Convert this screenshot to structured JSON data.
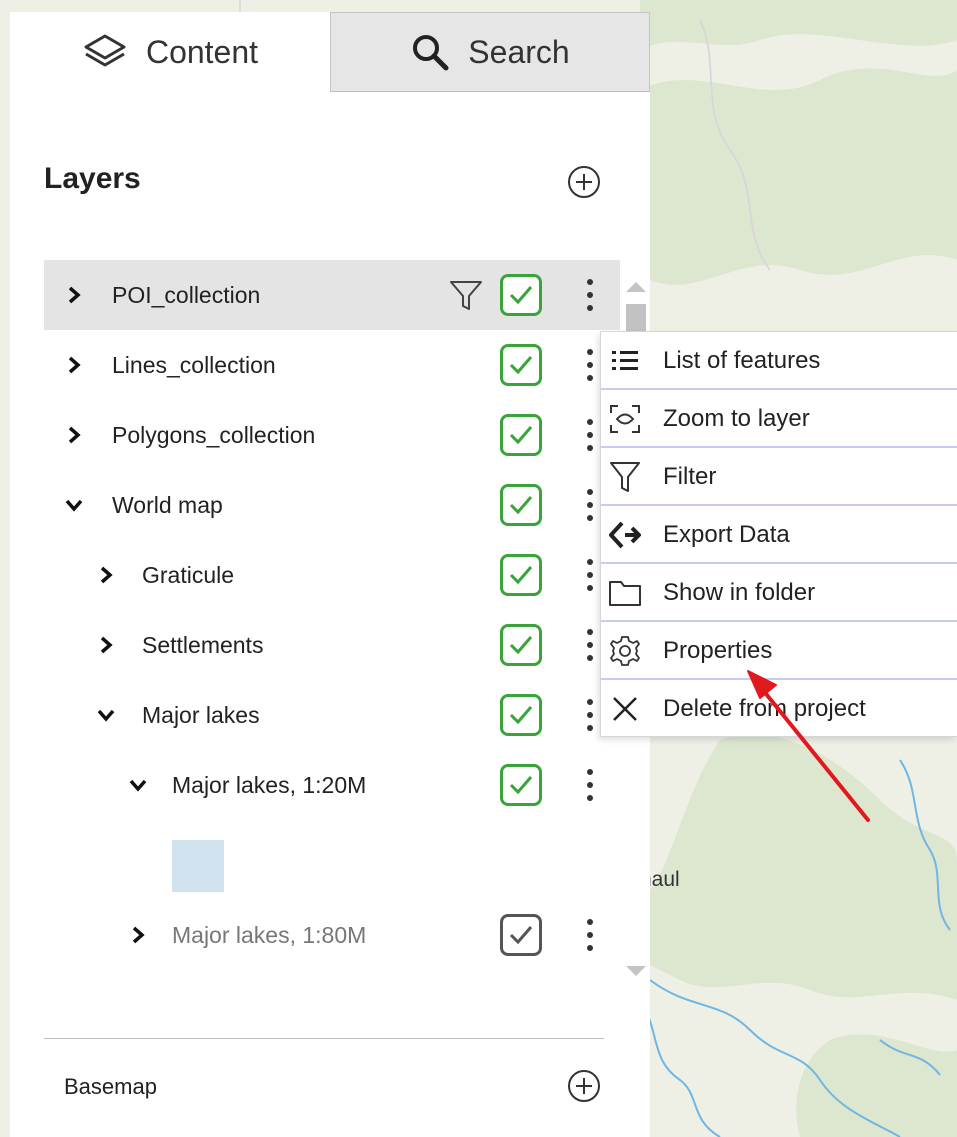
{
  "tabs": [
    {
      "label": "Content",
      "icon": "layers-icon",
      "active": true
    },
    {
      "label": "Search",
      "icon": "search-icon",
      "active": false
    }
  ],
  "layers": {
    "title": "Layers",
    "add_icon": "plus-circle-icon",
    "items": [
      {
        "label": "POI_collection",
        "expanded": false,
        "checked": true,
        "filtered": true,
        "selected": true
      },
      {
        "label": "Lines_collection",
        "expanded": false,
        "checked": true
      },
      {
        "label": "Polygons_collection",
        "expanded": false,
        "checked": true
      },
      {
        "label": "World map",
        "expanded": true,
        "checked": true
      },
      {
        "label": "Graticule",
        "expanded": false,
        "checked": true
      },
      {
        "label": "Settlements",
        "expanded": false,
        "checked": true
      },
      {
        "label": "Major lakes",
        "expanded": true,
        "checked": true
      },
      {
        "label": "Major lakes, 1:20M",
        "expanded": true,
        "checked": true
      },
      {
        "label": "Major lakes, 1:80M",
        "expanded": false,
        "checked": true,
        "muted": true
      }
    ],
    "legend_swatch_color": "#d2e3f0"
  },
  "basemap": {
    "title": "Basemap",
    "add_icon": "plus-circle-icon"
  },
  "context_menu": {
    "items": [
      {
        "label": "List of features",
        "icon": "list-icon"
      },
      {
        "label": "Zoom to layer",
        "icon": "zoom-extent-icon"
      },
      {
        "label": "Filter",
        "icon": "filter-icon"
      },
      {
        "label": "Export Data",
        "icon": "export-icon"
      },
      {
        "label": "Show in folder",
        "icon": "folder-icon"
      },
      {
        "label": "Properties",
        "icon": "gear-icon"
      },
      {
        "label": "Delete from project",
        "icon": "close-icon"
      }
    ]
  },
  "map": {
    "place_label": "naul"
  },
  "colors": {
    "check_green": "#3aa43a",
    "annotation_arrow": "#e0191f",
    "menu_separator": "#c9ccf2",
    "selected_row": "#e4e4e4",
    "map_land": "#eef0e6",
    "map_forest": "#dde6cf",
    "map_water": "#6fb6e3"
  }
}
